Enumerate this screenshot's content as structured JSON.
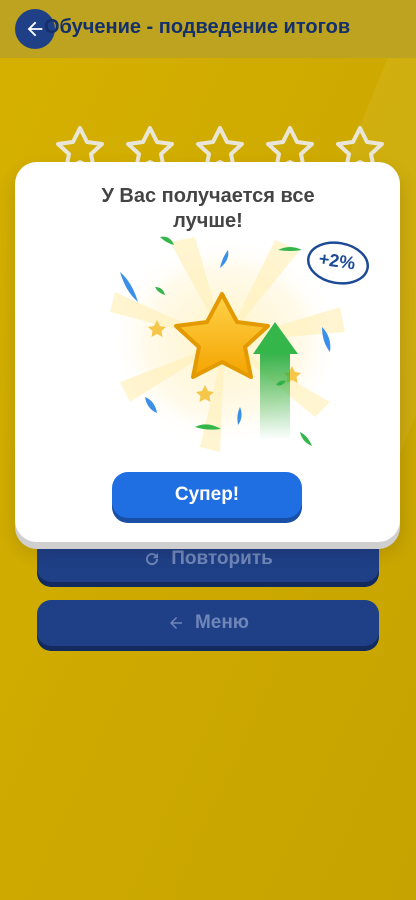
{
  "header": {
    "title": "Обучение - подведение итогов",
    "back_icon": "arrow-left-icon"
  },
  "colors": {
    "page_background": "#c9a700",
    "primary_blue": "#1f6fe3",
    "dark_blue": "#1f3f86",
    "star_gold": "#f7b500",
    "arrow_green": "#35b64a"
  },
  "modal": {
    "title": "У Вас получается все лучше!",
    "badge": "+2%",
    "button_label": "Супер!"
  },
  "behind_modal": {
    "stars_count": 5,
    "retry_label": "Повторить",
    "retry_icon": "refresh-icon",
    "menu_label": "Меню",
    "menu_icon": "arrow-left-icon"
  }
}
